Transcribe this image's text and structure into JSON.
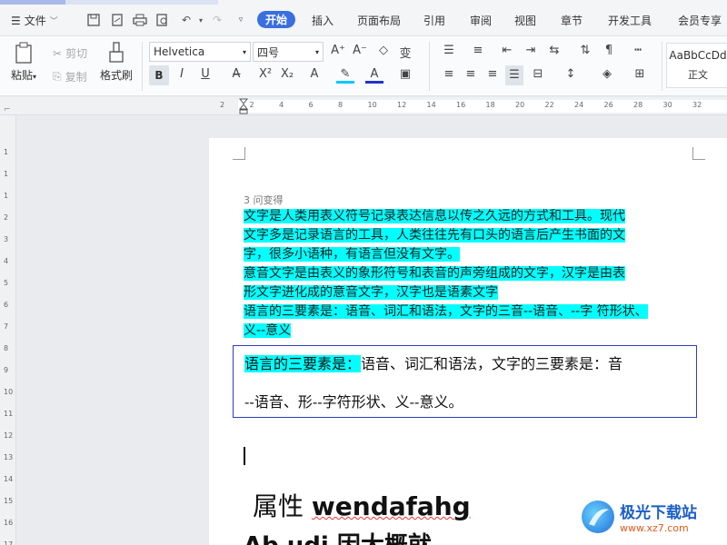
{
  "menu": {
    "file_label": "文件",
    "tabs": [
      "开始",
      "插入",
      "页面布局",
      "引用",
      "审阅",
      "视图",
      "章节",
      "开发工具",
      "会员专享"
    ]
  },
  "ribbon": {
    "paste": "粘贴",
    "cut": "剪切",
    "copy": "复制",
    "format_painter": "格式刷",
    "font_name": "Helvetica",
    "font_size": "四号",
    "style_sample": "AaBbCcDd",
    "style_name": "正文"
  },
  "ruler": {
    "top_numbers": [
      "2",
      "2",
      "4",
      "6",
      "8",
      "10",
      "12",
      "14",
      "16",
      "18",
      "20",
      "22",
      "24",
      "26",
      "28",
      "30",
      "32"
    ],
    "left_numbers": [
      "1",
      "1",
      "1",
      "2",
      "3",
      "4",
      "5",
      "6",
      "7",
      "8",
      "9",
      "10",
      "11",
      "12",
      "13",
      "14",
      "15",
      "16",
      "17"
    ]
  },
  "document": {
    "small_heading": "3 问变得",
    "para1_lines": [
      "文字是人类用表义符号记录表达信息以传之久远的方式和工具。现代",
      "文字多是记录语言的工具，人类往往先有口头的语言后产生书面的文",
      "字，很多小语种，有语言但没有文字。"
    ],
    "para2_lines": [
      "意音文字是由表义的象形符号和表音的声旁组成的文字，汉字是由表",
      "形文字进化成的意音文字，汉字也是语素文字"
    ],
    "para3_lines": [
      "语言的三要素是：语音、词汇和语法，文字的三音--语音、--字  符形状、",
      "义--意义"
    ],
    "textbox_hl": "语言的三要素是：",
    "textbox_rest": "语音、词汇和语法，文字的三要素是：音",
    "textbox_line2": "--语音、形--字符形状、义--意义。",
    "attr_cn": "属性",
    "attr_en": "wendafahg",
    "attr2": "Ab udi 因大概就"
  },
  "watermark": {
    "name": "极光下载站",
    "url": "www.xz7.com"
  },
  "colors": {
    "accent": "#3a6fe0",
    "highlight": "#00ffff",
    "textbox_border": "#2b3fbf"
  }
}
